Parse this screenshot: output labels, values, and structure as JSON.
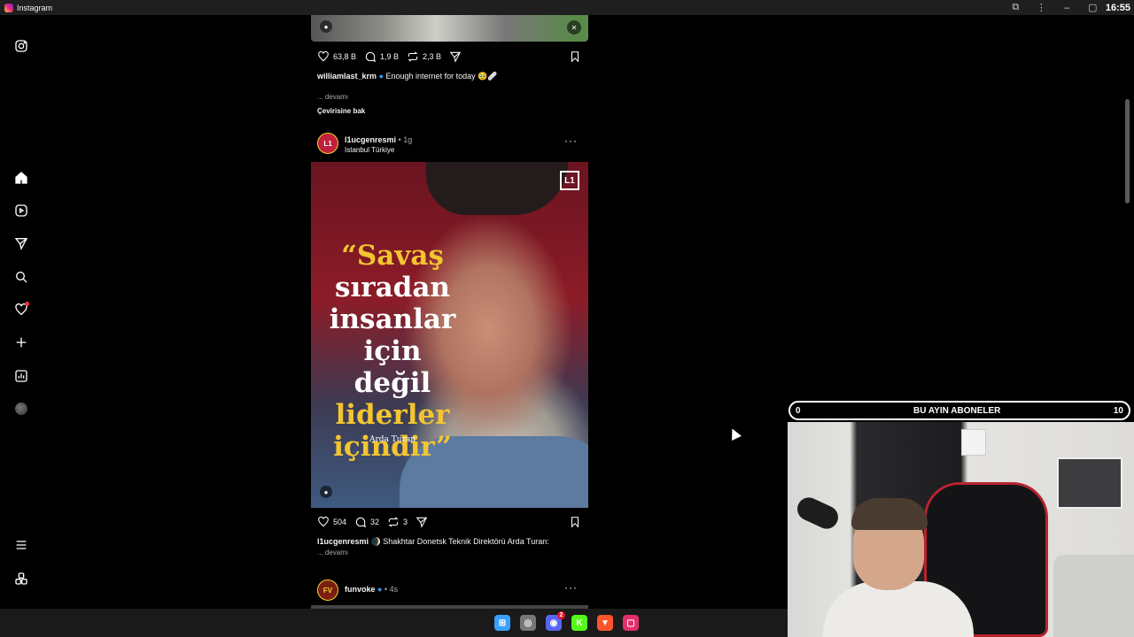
{
  "window": {
    "title": "Instagram",
    "clock": "16:55"
  },
  "sidebar": {
    "items": [
      {
        "name": "instagram-logo-icon"
      },
      {
        "name": "home-icon"
      },
      {
        "name": "reels-icon"
      },
      {
        "name": "messages-icon"
      },
      {
        "name": "search-icon"
      },
      {
        "name": "notifications-icon"
      },
      {
        "name": "create-icon"
      },
      {
        "name": "insights-icon"
      },
      {
        "name": "profile-avatar"
      },
      {
        "name": "menu-icon"
      },
      {
        "name": "also-from-meta-icon"
      }
    ]
  },
  "post1": {
    "likes": "63,8 B",
    "comments": "1,9 B",
    "reposts": "2,3 B",
    "username": "williamlast_krm",
    "caption": "Enough internet for today 🥹🩹",
    "more": "... devamı",
    "translate": "Çevirisine bak"
  },
  "post2": {
    "username": "l1ucgenresmi",
    "time": "1g",
    "location": "Istanbul Türkiye",
    "avatar_text": "L1",
    "logo_text": "L1",
    "quote_lines": [
      {
        "text": "“Savaş",
        "color": "yellow"
      },
      {
        "text": "sıradan",
        "color": "white"
      },
      {
        "text": "insanlar",
        "color": "white"
      },
      {
        "text": "için değil",
        "color": "white"
      },
      {
        "text": "liderler",
        "color": "yellow"
      },
      {
        "text": "içindir”",
        "color": "yellow"
      }
    ],
    "quote_author": "Arda Turan",
    "likes": "504",
    "comments": "32",
    "reposts": "3",
    "caption": "Shakhtar Donetsk Teknik Direktörü Arda Turan:",
    "caption_emoji": "🌒",
    "more": "... devamı"
  },
  "post3": {
    "username": "funvoke",
    "time": "4s",
    "avatar_text": "FV"
  },
  "overlay": {
    "subs_left": "0",
    "subs_title": "BU AYIN ABONELER",
    "subs_right": "10"
  },
  "colors": {
    "quote_yellow": "#f2c531",
    "notif_red": "#ff3040",
    "verified_blue": "#3897f0"
  },
  "taskbar": [
    {
      "name": "windows-start-icon",
      "glyph": "⊞",
      "color": "#3aa0ff"
    },
    {
      "name": "chrome-icon",
      "glyph": "◎",
      "color": "#777"
    },
    {
      "name": "discord-icon",
      "glyph": "◉",
      "color": "#5865f2",
      "badge": "2"
    },
    {
      "name": "kick-icon",
      "glyph": "K",
      "color": "#53fc18"
    },
    {
      "name": "brave-icon",
      "glyph": "▼",
      "color": "#fb542b"
    },
    {
      "name": "instagram-taskbar-icon",
      "glyph": "▢",
      "color": "#e1306c"
    }
  ]
}
